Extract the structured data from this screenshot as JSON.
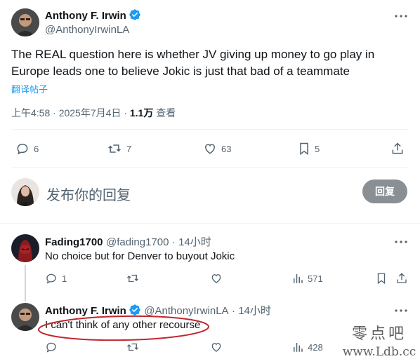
{
  "main_tweet": {
    "author_name": "Anthony F. Irwin",
    "author_handle": "@AnthonyIrwinLA",
    "text_line1": "The REAL question here is whether JV giving up money to go play in",
    "text_line2": "Europe leads one to believe Jokic is just that bad of a teammate",
    "translate_label": "翻译帖子",
    "time": "上午4:58 · 2025年7月4日 · ",
    "views_count": "1.1万",
    "views_label": " 查看",
    "stats": {
      "replies": "6",
      "retweets": "7",
      "likes": "63",
      "bookmarks": "5"
    }
  },
  "composer": {
    "placeholder": "发布你的回复",
    "reply_button": "回复"
  },
  "replies": [
    {
      "author_name": "Fading1700",
      "author_handle": "@fading1700",
      "time": "· 14小时",
      "text": "No choice but for Denver to buyout Jokic",
      "stats": {
        "replies": "1",
        "retweets": "",
        "likes": "",
        "views": "571"
      }
    },
    {
      "author_name": "Anthony F. Irwin",
      "author_handle": "@AnthonyIrwinLA",
      "time": "· 14小时",
      "text": "I can't think of any other recourse",
      "stats": {
        "replies": "",
        "retweets": "",
        "likes": "",
        "views": "428"
      }
    }
  ],
  "watermark": {
    "line1": "零点吧",
    "line2": "www.Ldb.cc"
  },
  "colors": {
    "verified": "#1d9bf0",
    "accent": "#1d9bf0",
    "annotation_circle": "#c0272d"
  }
}
